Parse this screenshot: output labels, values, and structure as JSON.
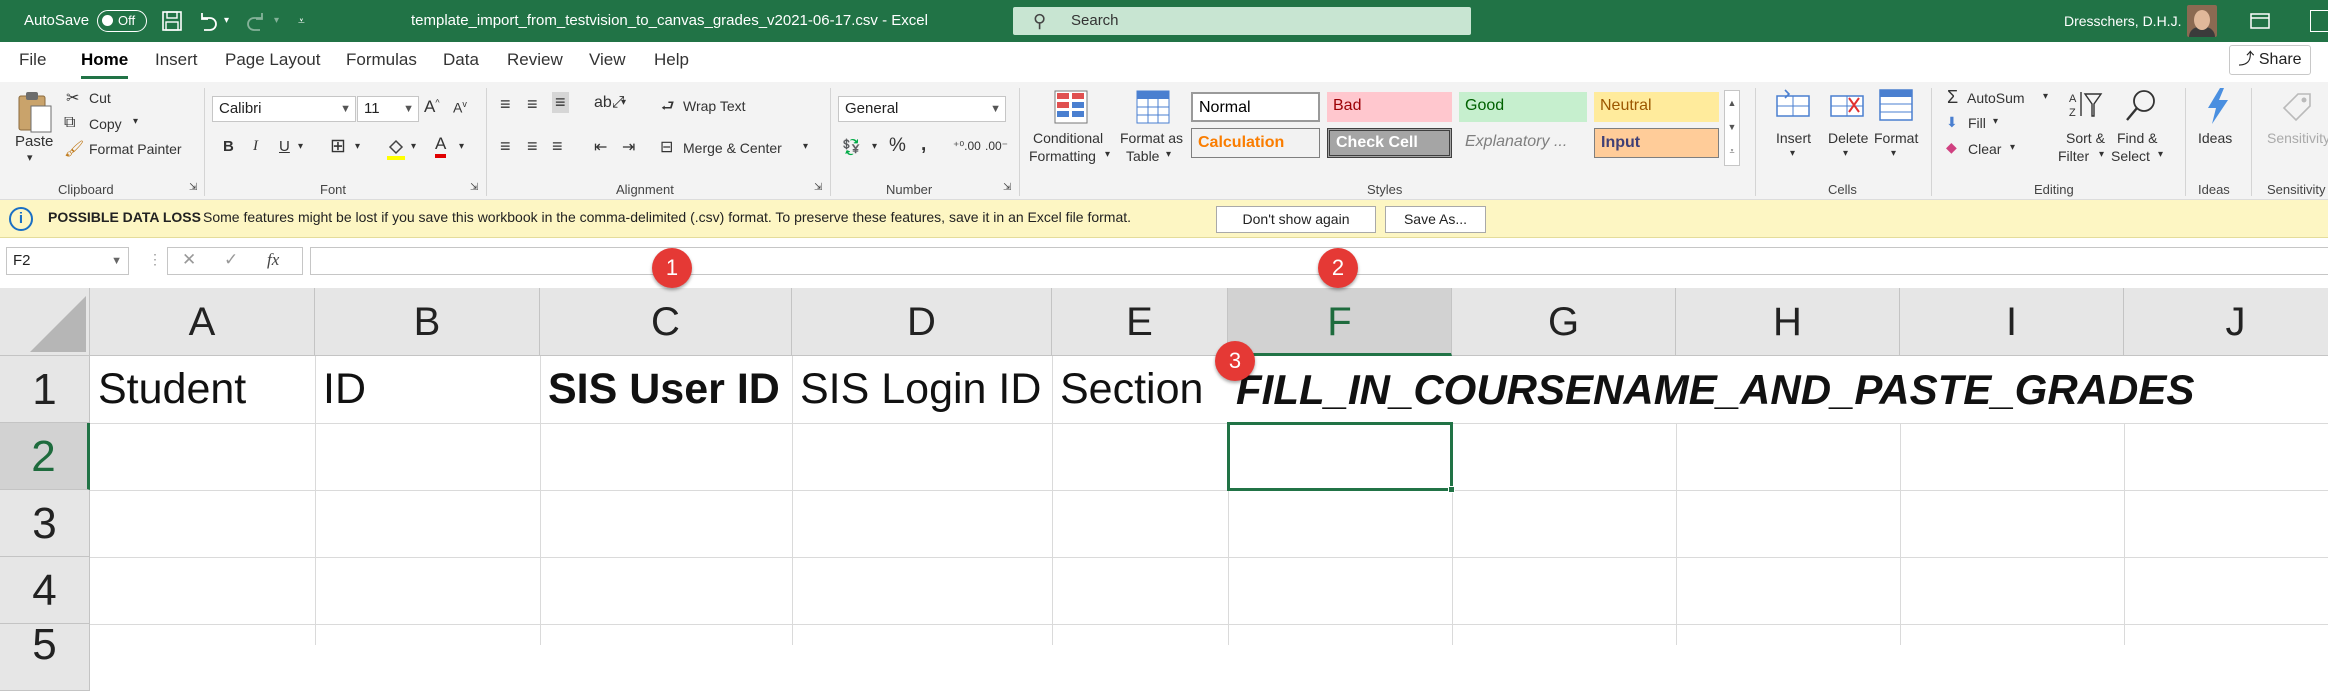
{
  "titlebar": {
    "autosave_label": "AutoSave",
    "autosave_state": "Off",
    "filename": "template_import_from_testvision_to_canvas_grades_v2021-06-17.csv",
    "separator": "-",
    "app_name": "Excel",
    "search_placeholder": "Search",
    "user_name": "Dresschers, D.H.J."
  },
  "tabs": [
    "File",
    "Home",
    "Insert",
    "Page Layout",
    "Formulas",
    "Data",
    "Review",
    "View",
    "Help"
  ],
  "active_tab": "Home",
  "share_label": "Share",
  "ribbon": {
    "clipboard": {
      "paste": "Paste",
      "cut": "Cut",
      "copy": "Copy",
      "format_painter": "Format Painter",
      "label": "Clipboard"
    },
    "font": {
      "name": "Calibri",
      "size": "11",
      "label": "Font"
    },
    "alignment": {
      "wrap_text": "Wrap Text",
      "merge_center": "Merge & Center",
      "label": "Alignment"
    },
    "number": {
      "format": "General",
      "label": "Number"
    },
    "styles": {
      "conditional_line1": "Conditional",
      "conditional_line2": "Formatting",
      "format_as_line1": "Format as",
      "format_as_line2": "Table",
      "cells": [
        {
          "name": "Normal",
          "bg": "#ffffff",
          "color": "#000000"
        },
        {
          "name": "Bad",
          "bg": "#ffc7ce",
          "color": "#9c0006"
        },
        {
          "name": "Good",
          "bg": "#c6efce",
          "color": "#006100"
        },
        {
          "name": "Neutral",
          "bg": "#ffeb9c",
          "color": "#9c5700"
        },
        {
          "name": "Calculation",
          "bg": "#f2f2f2",
          "color": "#fa7d00"
        },
        {
          "name": "Check Cell",
          "bg": "#a5a5a5",
          "color": "#ffffff"
        },
        {
          "name": "Explanatory ...",
          "bg": "#f3f3f3",
          "color": "#7f7f7f"
        },
        {
          "name": "Input",
          "bg": "#ffcc99",
          "color": "#3f3f76"
        }
      ],
      "label": "Styles"
    },
    "cells": {
      "insert": "Insert",
      "delete": "Delete",
      "format": "Format",
      "label": "Cells"
    },
    "editing": {
      "autosum": "AutoSum",
      "fill": "Fill",
      "clear": "Clear",
      "sort_line1": "Sort &",
      "sort_line2": "Filter",
      "find_line1": "Find &",
      "find_line2": "Select",
      "label": "Editing"
    },
    "ideas": {
      "button": "Ideas",
      "label": "Ideas"
    },
    "sensitivity": {
      "button": "Sensitivity",
      "label": "Sensitivity"
    }
  },
  "message_bar": {
    "title": "POSSIBLE DATA LOSS",
    "text": "Some features might be lost if you save this workbook in the comma-delimited (.csv) format. To preserve these features, save it in an Excel file format.",
    "btn_dont_show": "Don't show again",
    "btn_save_as": "Save As..."
  },
  "formula_bar": {
    "name_box": "F2",
    "cancel": "✕",
    "enter": "✓",
    "fx": "fx",
    "value": ""
  },
  "grid": {
    "columns": [
      "A",
      "B",
      "C",
      "D",
      "E",
      "F",
      "G",
      "H",
      "I",
      "J"
    ],
    "rows": [
      "1",
      "2",
      "3",
      "4",
      "5"
    ],
    "selected_column": "F",
    "selected_row": "2",
    "row1": {
      "A": "Student",
      "B": "ID",
      "C": "SIS User ID",
      "D": "SIS Login ID",
      "E": "Section",
      "F": "FILL_IN_COURSENAME_AND_PASTE_GRADES"
    }
  },
  "annotations": [
    "1",
    "2",
    "3"
  ],
  "colors": {
    "excel_green": "#217346",
    "badge_red": "#e53935",
    "message_bar": "#fdf6c3"
  }
}
